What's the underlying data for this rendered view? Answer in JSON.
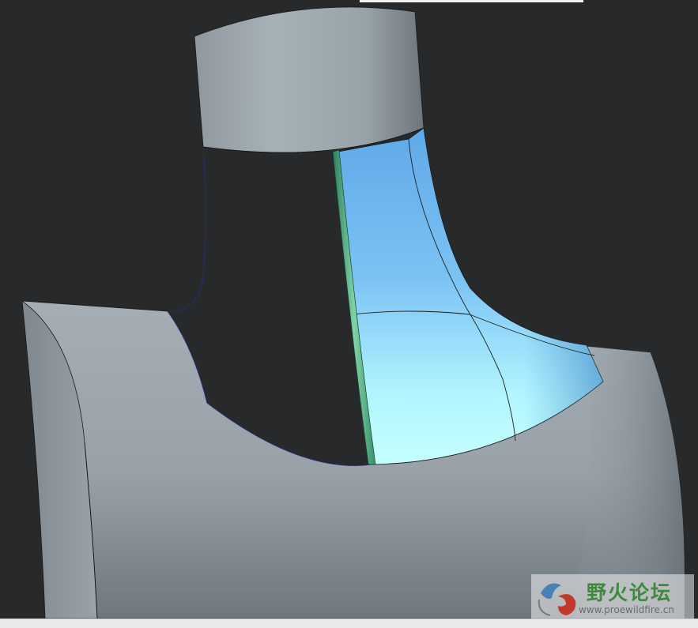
{
  "viewport": {
    "background_color": "#27292b",
    "model": {
      "body_color": "#a3adb4",
      "highlighted_surface_color": "#6ab8f0",
      "highlighted_surface_light": "#b9ffff",
      "edge_highlight_color": "#4fae7e",
      "boundary_curve_color": "#2a2a7a"
    }
  },
  "watermark": {
    "title": "野火论坛",
    "url": "www.proewildfire.cn",
    "logo_icon": "butterfly-swirl-icon"
  }
}
